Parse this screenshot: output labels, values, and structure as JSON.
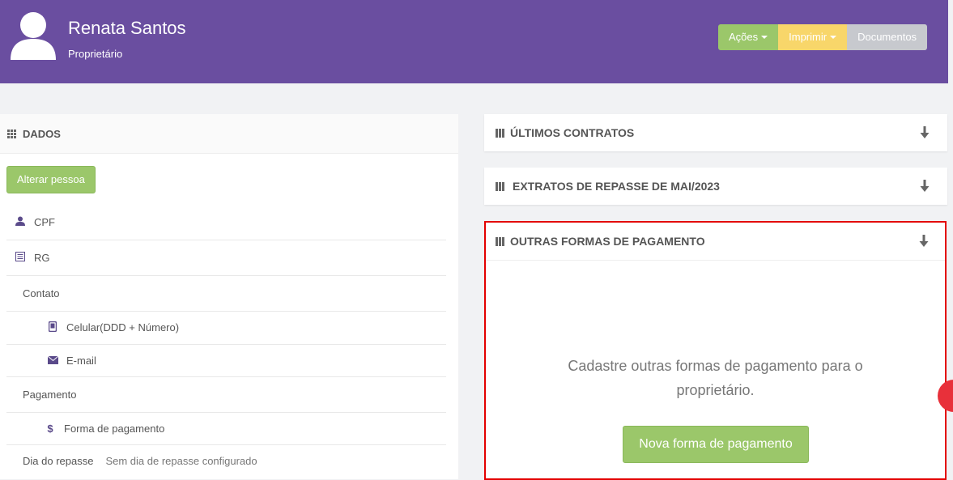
{
  "header": {
    "name": "Renata Santos",
    "role": "Proprietário",
    "actions_label": "Ações",
    "print_label": "Imprimir",
    "documents_label": "Documentos"
  },
  "dados": {
    "title": "DADOS",
    "edit_button": "Alterar pessoa",
    "cpf": "CPF",
    "rg": "RG",
    "contato": "Contato",
    "celular": "Celular(DDD + Número)",
    "email": "E-mail",
    "pagamento": "Pagamento",
    "forma_pagamento": "Forma de pagamento",
    "dia_repasse_label": "Dia do repasse",
    "dia_repasse_value": "Sem dia de repasse configurado"
  },
  "cards": {
    "contratos": "ÚLTIMOS CONTRATOS",
    "extratos": "EXTRATOS DE REPASSE DE MAI/2023",
    "outras": "OUTRAS FORMAS DE PAGAMENTO",
    "empty_text": "Cadastre outras formas de pagamento para o proprietário.",
    "new_button": "Nova forma de pagamento"
  },
  "colors": {
    "header": "#6a4ea0",
    "green": "#9bc76a",
    "yellow": "#f8d66a",
    "gray": "#c7c9ce",
    "highlight": "#e30000"
  }
}
